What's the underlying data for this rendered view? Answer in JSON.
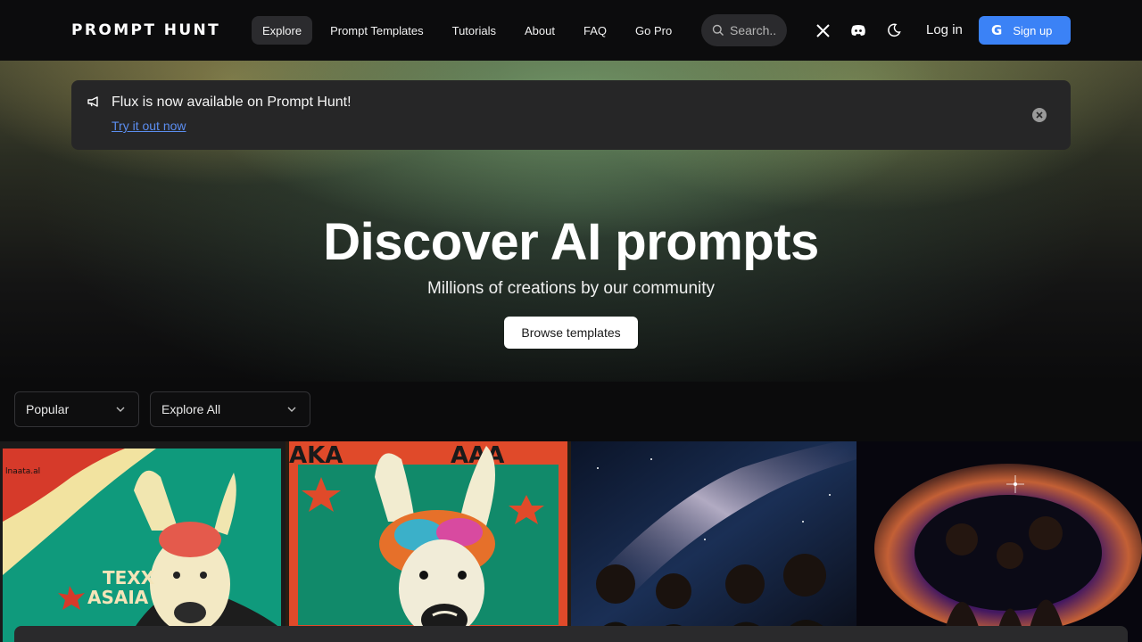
{
  "brand": {
    "logo_text": "PROMPT HUNT"
  },
  "nav": {
    "links": [
      {
        "label": "Explore",
        "active": true
      },
      {
        "label": "Prompt Templates",
        "active": false
      },
      {
        "label": "Tutorials",
        "active": false
      },
      {
        "label": "About",
        "active": false
      },
      {
        "label": "FAQ",
        "active": false
      },
      {
        "label": "Go Pro",
        "active": false
      }
    ],
    "search_placeholder": "Search..",
    "icons": [
      "x-twitter-icon",
      "discord-icon",
      "moon-icon"
    ],
    "login_label": "Log in",
    "signup_label": "Sign up",
    "signup_icon": "google-icon",
    "accent_color": "#3b82f6"
  },
  "banner": {
    "icon": "megaphone-icon",
    "title": "Flux is now available on Prompt Hunt!",
    "link_text": "Try it out now",
    "close_icon": "close-circle-icon"
  },
  "hero": {
    "title": "Discover AI prompts",
    "subtitle": "Millions of creations by our community",
    "cta_label": "Browse templates"
  },
  "filters": {
    "sort": {
      "value": "Popular"
    },
    "category": {
      "value": "Explore All"
    }
  },
  "gallery": {
    "tiles": [
      {
        "alt": "llama poster",
        "text": "TEXX ASAIA"
      },
      {
        "alt": "colorful llama poster",
        "text": "AKA AAA"
      },
      {
        "alt": "people under galaxy sky",
        "text": ""
      },
      {
        "alt": "couple in cosmic heart",
        "text": ""
      }
    ]
  }
}
